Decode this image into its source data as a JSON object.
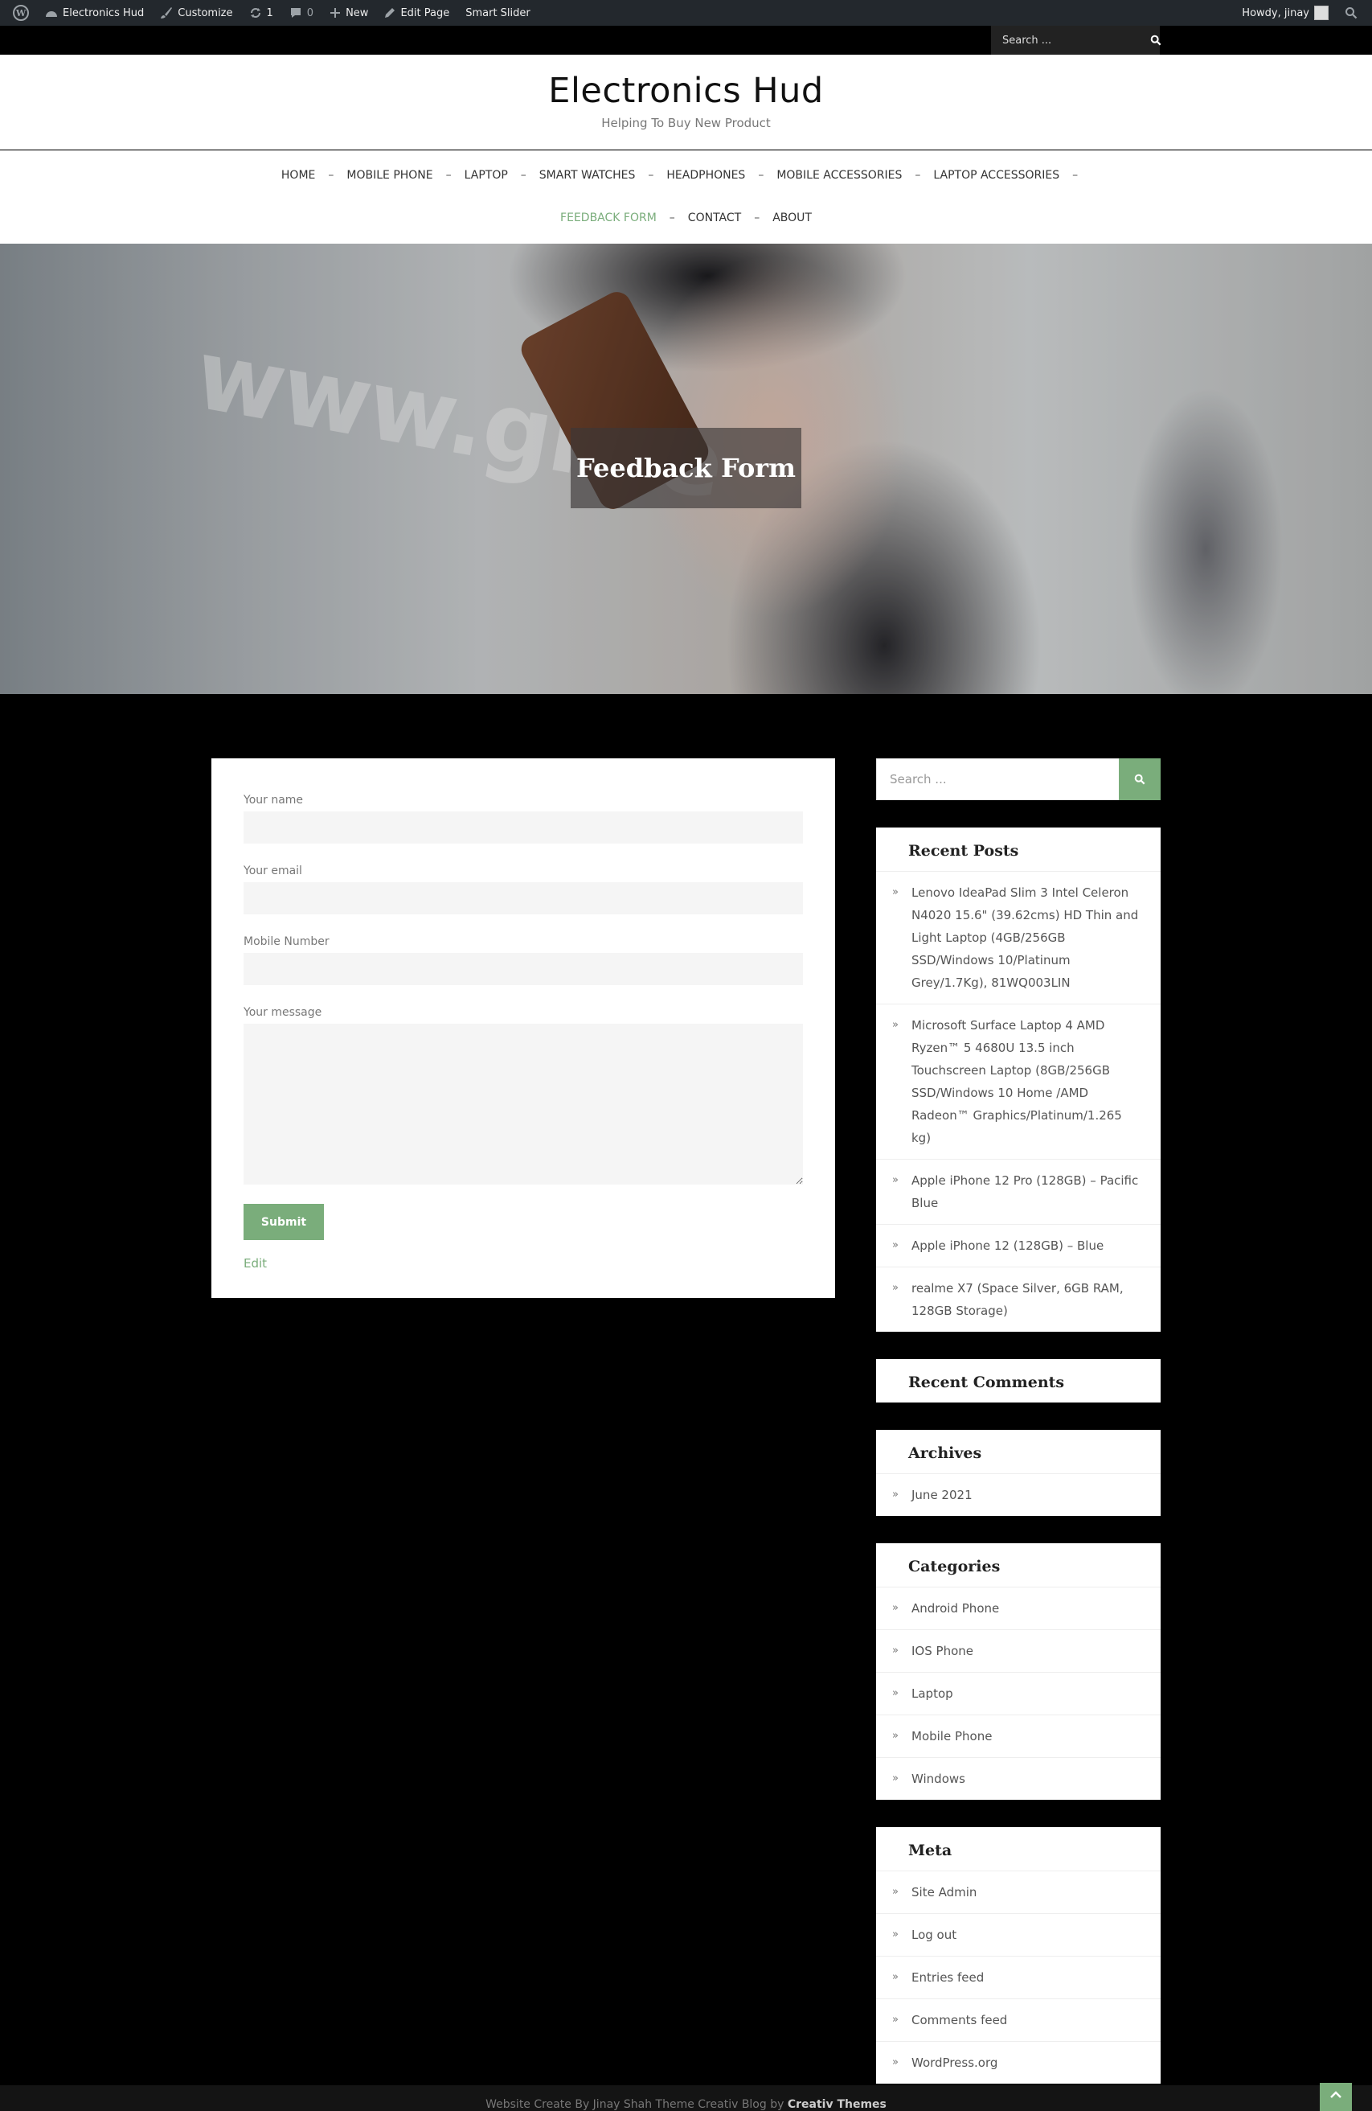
{
  "admin_bar": {
    "site_name": "Electronics Hud",
    "customize": "Customize",
    "updates_count": "1",
    "comments_count": "0",
    "new": "New",
    "edit_page": "Edit Page",
    "smart_slider": "Smart Slider",
    "howdy": "Howdy, jinay"
  },
  "top_search": {
    "placeholder": "Search ..."
  },
  "header": {
    "title": "Electronics Hud",
    "tagline": "Helping To Buy New Product"
  },
  "nav": {
    "row1": [
      "HOME",
      "MOBILE PHONE",
      "LAPTOP",
      "SMART WATCHES",
      "HEADPHONES",
      "MOBILE ACCESSORIES",
      "LAPTOP ACCESSORIES"
    ],
    "row2": [
      "FEEDBACK FORM",
      "CONTACT",
      "ABOUT"
    ],
    "separator": "–",
    "active": "FEEDBACK FORM"
  },
  "hero": {
    "title": "Feedback Form",
    "background_text": "www.gree"
  },
  "form": {
    "name_label": "Your name",
    "email_label": "Your email",
    "mobile_label": "Mobile Number",
    "message_label": "Your message",
    "submit_label": "Submit",
    "edit_link": "Edit"
  },
  "sidebar": {
    "search_placeholder": "Search ...",
    "recent_posts": {
      "title": "Recent Posts",
      "items": [
        "Lenovo IdeaPad Slim 3 Intel Celeron N4020 15.6\" (39.62cms) HD Thin and Light Laptop (4GB/256GB SSD/Windows 10/Platinum Grey/1.7Kg), 81WQ003LIN",
        "Microsoft Surface Laptop 4 AMD Ryzen™ 5 4680U 13.5 inch Touchscreen Laptop (8GB/256GB SSD/Windows 10 Home /AMD Radeon™ Graphics/Platinum/1.265 kg)",
        "Apple iPhone 12 Pro (128GB) – Pacific Blue",
        "Apple iPhone 12 (128GB) – Blue",
        "realme X7 (Space Silver, 6GB RAM, 128GB Storage)"
      ]
    },
    "recent_comments": {
      "title": "Recent Comments"
    },
    "archives": {
      "title": "Archives",
      "items": [
        "June 2021"
      ]
    },
    "categories": {
      "title": "Categories",
      "items": [
        "Android Phone",
        "IOS Phone",
        "Laptop",
        "Mobile Phone",
        "Windows"
      ]
    },
    "meta": {
      "title": "Meta",
      "items": [
        "Site Admin",
        "Log out",
        "Entries feed",
        "Comments feed",
        "WordPress.org"
      ]
    }
  },
  "footer": {
    "text": "Website Create By Jinay Shah Theme Creativ Blog by",
    "brand": "Creativ Themes"
  },
  "colors": {
    "accent": "#7aad7b",
    "admin_bar": "#23282d",
    "page_bg": "#000000"
  }
}
